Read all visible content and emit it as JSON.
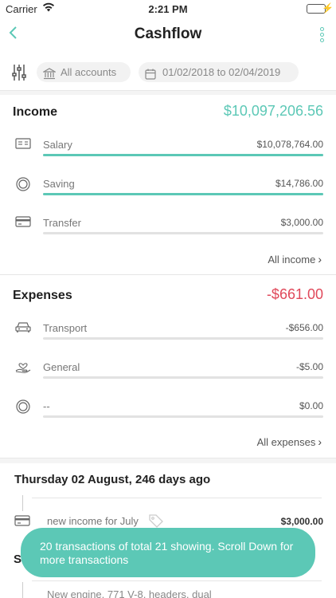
{
  "status": {
    "carrier": "Carrier",
    "time": "2:21 PM"
  },
  "nav": {
    "title": "Cashflow",
    "back_icon": "chevron-left-icon",
    "more_icon": "more-vertical-icon"
  },
  "filters": {
    "accounts": "All accounts",
    "date_range": "01/02/2018 to 02/04/2019"
  },
  "income": {
    "label": "Income",
    "total": "$10,097,206.56",
    "items": [
      {
        "name": "Salary",
        "amount": "$10,078,764.00",
        "fill": 1.0
      },
      {
        "name": "Saving",
        "amount": "$14,786.00",
        "fill": 1.0
      },
      {
        "name": "Transfer",
        "amount": "$3,000.00",
        "fill": 0.0
      }
    ],
    "more_label": "All income"
  },
  "expenses": {
    "label": "Expenses",
    "total": "-$661.00",
    "items": [
      {
        "name": "Transport",
        "amount": "-$656.00",
        "fill": 0.0
      },
      {
        "name": "General",
        "amount": "-$5.00",
        "fill": 0.0
      },
      {
        "name": "--",
        "amount": "$0.00",
        "fill": 0.0
      }
    ],
    "more_label": "All expenses"
  },
  "transactions": {
    "day_heading": "Thursday 02 August, 246 days ago",
    "items": [
      {
        "name": "new income for July",
        "amount": "$3,000.00"
      }
    ],
    "partial_heading": "S",
    "partial_item": "New engine, 771 V-8, headers, dual"
  },
  "toast": {
    "message": "20 transactions of total 21 showing. Scroll Down for more transactions"
  },
  "colors": {
    "accent": "#5cc8b6",
    "expense": "#e0485a"
  }
}
